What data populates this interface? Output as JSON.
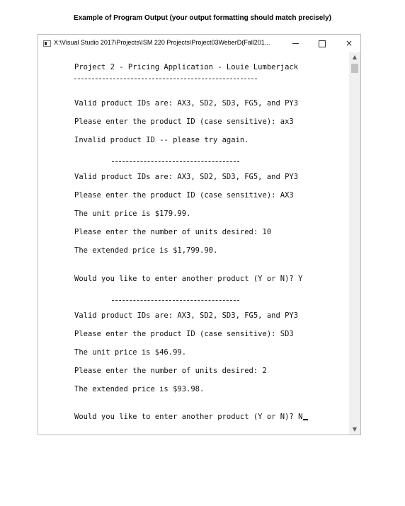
{
  "caption": "Example of Program Output (your output formatting should match precisely)",
  "window": {
    "title": "X:\\Visual Studio 2017\\Projects\\ISM 220 Projects\\Project03WeberD(Fall201...",
    "controls": {
      "minimize": "minimize",
      "maximize": "maximize",
      "close": "×"
    }
  },
  "console": {
    "header": "Project 2 - Pricing Application - Louie Lumberjack",
    "block1": {
      "valid_ids": "Valid product IDs are: AX3, SD2, SD3, FG5, and PY3",
      "prompt": "Please enter the product ID (case sensitive): ax3",
      "error": "Invalid product ID -- please try again."
    },
    "block2": {
      "valid_ids": "Valid product IDs are: AX3, SD2, SD3, FG5, and PY3",
      "prompt": "Please enter the product ID (case sensitive): AX3",
      "unit_price": "The unit price is $179.99.",
      "units_prompt": "Please enter the number of units desired: 10",
      "extended": "The extended price is $1,799.90.",
      "again": "Would you like to enter another product (Y or N)? Y"
    },
    "block3": {
      "valid_ids": "Valid product IDs are: AX3, SD2, SD3, FG5, and PY3",
      "prompt": "Please enter the product ID (case sensitive): SD3",
      "unit_price": "The unit price is $46.99.",
      "units_prompt": "Please enter the number of units desired: 2",
      "extended": "The extended price is $93.98.",
      "again": "Would you like to enter another product (Y or N)? N"
    }
  },
  "scrollbar": {
    "up": "▲",
    "down": "▼"
  }
}
